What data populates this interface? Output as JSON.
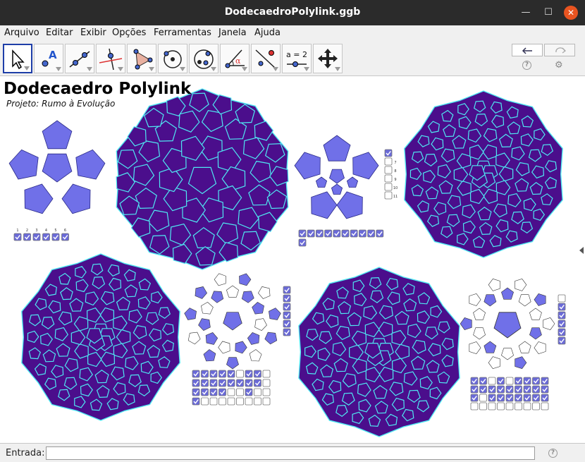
{
  "window": {
    "title": "DodecaedroPolylink.ggb",
    "minimize_glyph": "—",
    "maximize_glyph": "☐",
    "close_glyph": "✕"
  },
  "menu": {
    "items": [
      "Arquivo",
      "Editar",
      "Exibir",
      "Opções",
      "Ferramentas",
      "Janela",
      "Ajuda"
    ]
  },
  "toolbar": {
    "tools": [
      {
        "name": "move",
        "icon": "cursor-arrow-icon"
      },
      {
        "name": "point",
        "icon": "point-a-icon",
        "label": "A"
      },
      {
        "name": "line",
        "icon": "line-through-points-icon"
      },
      {
        "name": "perpendicular",
        "icon": "perpendicular-line-icon"
      },
      {
        "name": "polygon",
        "icon": "polygon-icon"
      },
      {
        "name": "circle",
        "icon": "circle-center-point-icon"
      },
      {
        "name": "conic",
        "icon": "ellipse-icon"
      },
      {
        "name": "angle",
        "icon": "angle-icon",
        "label": "α"
      },
      {
        "name": "reflect",
        "icon": "reflect-line-icon"
      },
      {
        "name": "slider",
        "icon": "slider-icon",
        "label": "a = 2"
      },
      {
        "name": "move-view",
        "icon": "move-graphics-view-icon"
      }
    ],
    "undo_icon": "undo-icon",
    "redo_icon": "redo-icon",
    "help_glyph": "?",
    "settings_glyph": "⚙"
  },
  "canvas": {
    "title": "Dodecaedro Polylink",
    "subtitle": "Projeto: Rumo à Evolução"
  },
  "colors": {
    "solid_fill": "#4b0e8c",
    "solid_edge": "#4fe8f2",
    "net_fill": "#7070e8",
    "net_edge": "#2b2b88",
    "checkbox_fill": "#6a6ad8"
  },
  "figures": [
    {
      "name": "net-1",
      "checkbox_numbers": [
        "1",
        "2",
        "3",
        "4",
        "5",
        "6"
      ],
      "checkboxes": [
        true,
        true,
        true,
        true,
        true,
        true
      ]
    },
    {
      "name": "net-2",
      "side_labels": [
        "7",
        "8",
        "9",
        "10",
        "11"
      ],
      "side_checks": [
        true,
        false,
        false,
        false,
        false,
        false
      ],
      "bottom_checks": [
        true,
        true,
        true,
        true,
        true,
        true,
        true,
        true,
        true,
        true
      ]
    },
    {
      "name": "net-3",
      "side_checks": [
        true,
        true,
        true,
        true,
        true,
        true
      ],
      "grid": [
        [
          true,
          true,
          true,
          true,
          true,
          false,
          true,
          true,
          false
        ],
        [
          true,
          true,
          true,
          true,
          true,
          true,
          true,
          true,
          false
        ],
        [
          true,
          true,
          true,
          true,
          false,
          false,
          true,
          false,
          false
        ],
        [
          true,
          false,
          false,
          false,
          false,
          false,
          false,
          false,
          false
        ]
      ]
    },
    {
      "name": "net-4",
      "side_checks": [
        false,
        true,
        true,
        true,
        true,
        true
      ],
      "grid": [
        [
          true,
          true,
          false,
          true,
          false,
          true,
          true,
          true,
          true
        ],
        [
          true,
          true,
          true,
          true,
          true,
          true,
          true,
          true,
          true
        ],
        [
          true,
          false,
          true,
          true,
          true,
          true,
          true,
          true,
          true
        ],
        [
          false,
          false,
          false,
          false,
          false,
          false,
          false,
          false,
          false
        ]
      ]
    }
  ],
  "input_bar": {
    "label": "Entrada:",
    "value": "",
    "help_glyph": "?"
  }
}
